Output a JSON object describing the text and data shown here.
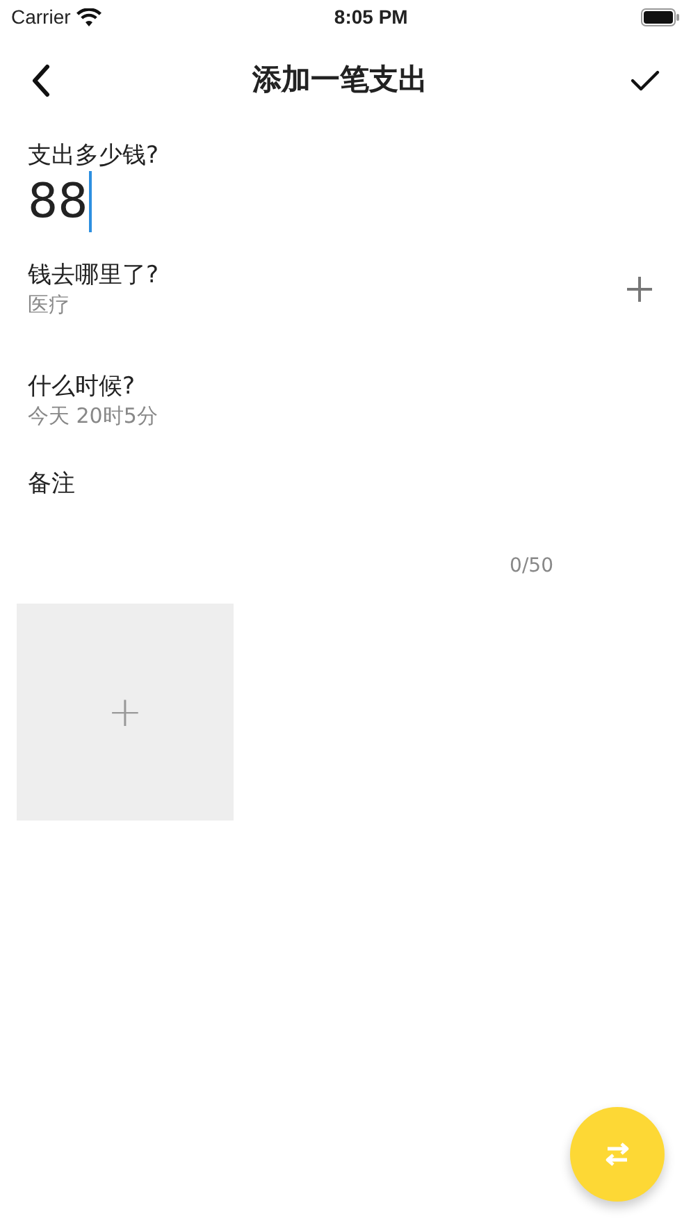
{
  "status_bar": {
    "carrier": "Carrier",
    "time": "8:05 PM"
  },
  "nav": {
    "title": "添加一笔支出"
  },
  "amount": {
    "label": "支出多少钱?",
    "value": "88",
    "focused": true
  },
  "fields": [
    {
      "kind": "picker",
      "label": "钱去哪里了?",
      "value": "医疗",
      "has_add": true
    },
    {
      "kind": "picker",
      "label": "什么时候?",
      "value": "今天 20时5分",
      "has_add": false
    }
  ],
  "note": {
    "label": "备注",
    "counter": "0/50"
  },
  "photos": {
    "add_tile": "+"
  }
}
